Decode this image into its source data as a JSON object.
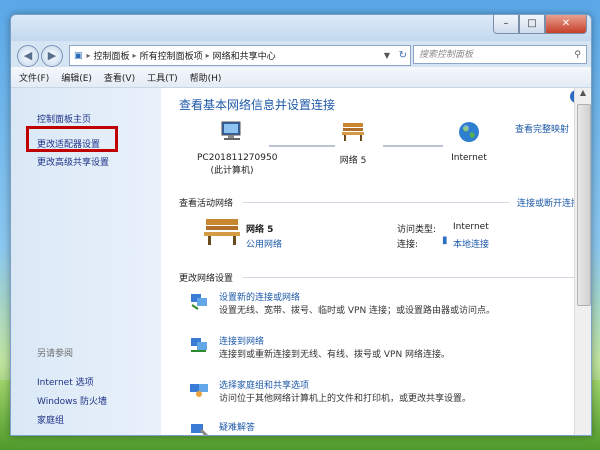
{
  "window": {
    "minimize_glyph": "–",
    "maximize_glyph": "□",
    "close_glyph": "✕"
  },
  "address": {
    "back_glyph": "◀",
    "forward_glyph": "▶",
    "crumbs": [
      "控制面板",
      "所有控制面板项",
      "网络和共享中心"
    ],
    "separator": "▸",
    "search_placeholder": "搜索控制面板"
  },
  "menu": {
    "items": [
      "文件(F)",
      "编辑(E)",
      "查看(V)",
      "工具(T)",
      "帮助(H)"
    ]
  },
  "sidebar": {
    "home": "控制面板主页",
    "adapter": "更改适配器设置",
    "advanced": "更改高级共享设置",
    "see_also": "另请参阅",
    "links": [
      "Internet 选项",
      "Windows 防火墙",
      "家庭组"
    ]
  },
  "main": {
    "title": "查看基本网络信息并设置连接",
    "full_map": "查看完整映射",
    "help_glyph": "?",
    "computer_name": "PC201811270950",
    "computer_sub": "(此计算机)",
    "network_node": "网络  5",
    "internet_node": "Internet",
    "active_header": "查看活动网络",
    "connect_link": "连接或断开连接",
    "network_name": "网络  5",
    "network_type": "公用网络",
    "access_label": "访问类型:",
    "access_value": "Internet",
    "conn_label": "连接:",
    "conn_value": "本地连接",
    "change_header": "更改网络设置",
    "tasks": [
      {
        "link": "设置新的连接或网络",
        "desc": "设置无线、宽带、拨号、临时或 VPN 连接；或设置路由器或访问点。"
      },
      {
        "link": "连接到网络",
        "desc": "连接到或重新连接到无线、有线、拨号或 VPN 网络连接。"
      },
      {
        "link": "选择家庭组和共享选项",
        "desc": "访问位于其他网络计算机上的文件和打印机，或更改共享设置。"
      },
      {
        "link": "疑难解答",
        "desc": ""
      }
    ]
  },
  "colors": {
    "link": "#1e5aa8",
    "highlight_box": "#c00000"
  }
}
